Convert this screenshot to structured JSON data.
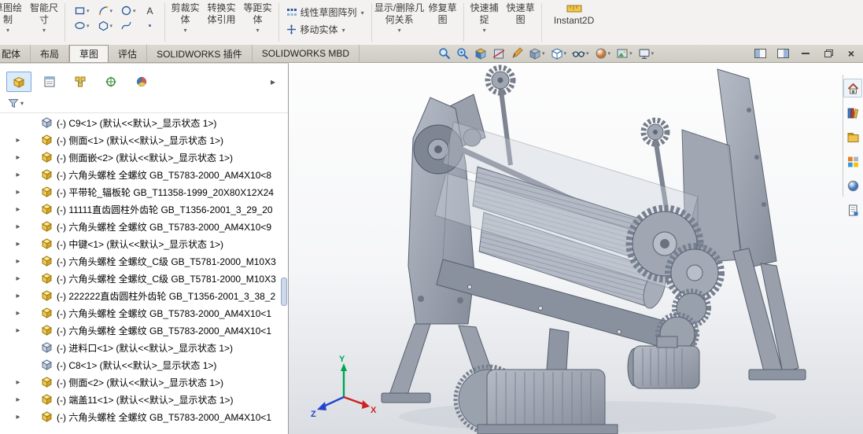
{
  "ribbon": {
    "buttons": [
      {
        "label": "草图绘制",
        "caret": true
      },
      {
        "label": "智能尺寸",
        "caret": true
      },
      {
        "label": "剪裁实体",
        "caret": true
      },
      {
        "label": "转换实体引用",
        "caret": false
      },
      {
        "label": "等距实体",
        "caret": true
      },
      {
        "label": "线性草图阵列",
        "caret": true
      },
      {
        "label": "移动实体",
        "caret": true
      },
      {
        "label": "显示/删除几何关系",
        "caret": true
      },
      {
        "label": "修复草图",
        "caret": false
      },
      {
        "label": "快速捕捉",
        "caret": true
      },
      {
        "label": "快速草图",
        "caret": false
      },
      {
        "label": "Instant2D",
        "caret": false
      }
    ],
    "sketch_tools": [
      "rectangle-tool",
      "arc-tool",
      "circle-tool",
      "text-tool",
      "ellipse-tool",
      "polygon-tool",
      "spline-tool",
      "point-tool"
    ]
  },
  "tabs": {
    "items": [
      {
        "label": "配体",
        "state": "inactive"
      },
      {
        "label": "布局",
        "state": "inactive"
      },
      {
        "label": "草图",
        "state": "active"
      },
      {
        "label": "评估",
        "state": "inactive"
      },
      {
        "label": "SOLIDWORKS 插件",
        "state": "inactive"
      },
      {
        "label": "SOLIDWORKS MBD",
        "state": "inactive"
      }
    ]
  },
  "headsup": {
    "icons": [
      "zoom-to-fit",
      "zoom-to-area",
      "view-selector",
      "section-view",
      "sketch-visibility",
      "view-orientation",
      "display-style",
      "hide-show-items",
      "edit-appearance",
      "apply-scene",
      "view-settings"
    ]
  },
  "window": {
    "controls": [
      "pane-left",
      "pane-right",
      "minimize",
      "restore",
      "close"
    ]
  },
  "taskpane": {
    "icons": [
      "home",
      "design-library",
      "file-explorer",
      "view-palette",
      "appearances",
      "custom-properties"
    ]
  },
  "panel": {
    "tabs": [
      "featuremanager",
      "propertymanager",
      "configurationmanager",
      "dimxpertmanager",
      "displaymanager"
    ],
    "filter": {
      "value": "",
      "placeholder": ""
    }
  },
  "tree": {
    "items": [
      {
        "expandable": false,
        "icon": "part2",
        "label": "(-) C9<1> (默认<<默认>_显示状态 1>)"
      },
      {
        "expandable": true,
        "icon": "part",
        "label": "(-) 侧面<1> (默认<<默认>_显示状态 1>)"
      },
      {
        "expandable": true,
        "icon": "part",
        "label": "(-) 侧面嵌<2> (默认<<默认>_显示状态 1>)"
      },
      {
        "expandable": true,
        "icon": "part",
        "label": "(-) 六角头螺栓 全螺纹 GB_T5783-2000_AM4X10<8"
      },
      {
        "expandable": true,
        "icon": "part",
        "label": "(-) 平带轮_辐板轮 GB_T11358-1999_20X80X12X24"
      },
      {
        "expandable": true,
        "icon": "part",
        "label": "(-) 11111直齿圆柱外齿轮 GB_T1356-2001_3_29_20"
      },
      {
        "expandable": true,
        "icon": "part",
        "label": "(-) 六角头螺栓 全螺纹 GB_T5783-2000_AM4X10<9"
      },
      {
        "expandable": true,
        "icon": "part",
        "label": "(-) 中键<1> (默认<<默认>_显示状态 1>)"
      },
      {
        "expandable": true,
        "icon": "part",
        "label": "(-) 六角头螺栓 全螺纹_C级 GB_T5781-2000_M10X3"
      },
      {
        "expandable": true,
        "icon": "part",
        "label": "(-) 六角头螺栓 全螺纹_C级 GB_T5781-2000_M10X3"
      },
      {
        "expandable": true,
        "icon": "part",
        "label": "(-) 222222直齿圆柱外齿轮 GB_T1356-2001_3_38_2"
      },
      {
        "expandable": true,
        "icon": "part",
        "label": "(-) 六角头螺栓 全螺纹 GB_T5783-2000_AM4X10<1"
      },
      {
        "expandable": true,
        "icon": "part",
        "label": "(-) 六角头螺栓 全螺纹 GB_T5783-2000_AM4X10<1"
      },
      {
        "expandable": false,
        "icon": "part2",
        "label": "(-) 进料口<1> (默认<<默认>_显示状态 1>)"
      },
      {
        "expandable": false,
        "icon": "part2",
        "label": "(-) C8<1> (默认<<默认>_显示状态 1>)"
      },
      {
        "expandable": true,
        "icon": "part",
        "label": "(-) 侧面<2> (默认<<默认>_显示状态 1>)"
      },
      {
        "expandable": true,
        "icon": "part",
        "label": "(-) 端盖11<1> (默认<<默认>_显示状态 1>)"
      },
      {
        "expandable": true,
        "icon": "part",
        "label": "(-) 六角头螺栓 全螺纹 GB_T5783-2000_AM4X10<1"
      }
    ]
  },
  "viewport": {
    "triad": {
      "x_label": "X",
      "y_label": "Y",
      "z_label": "Z",
      "x_color": "#cc2222",
      "y_color": "#00a550",
      "z_color": "#2244cc"
    }
  },
  "colors": {
    "accent": "#2c6fb7",
    "tab_band": "#d6d2ca",
    "panel_border": "#9b9b9b",
    "part_icon": "#f2c84b"
  }
}
